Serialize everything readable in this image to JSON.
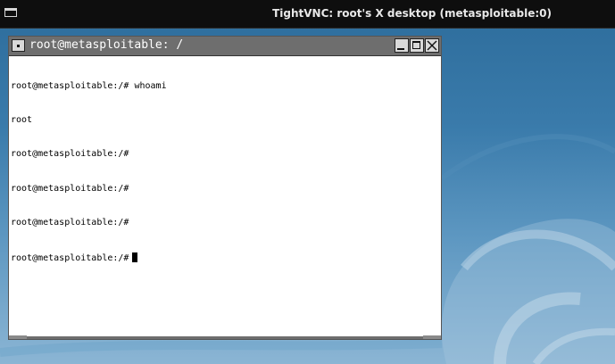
{
  "vnc": {
    "title": "TightVNC: root's X desktop (metasploitable:0)"
  },
  "xterm": {
    "title": "root@metasploitable: /",
    "lines": [
      "root@metasploitable:/# whoami",
      "root",
      "root@metasploitable:/#",
      "root@metasploitable:/#",
      "root@metasploitable:/#",
      "root@metasploitable:/#"
    ]
  },
  "icons": {
    "vnc_window_icon": "window-icon",
    "menu": "window-menu-icon",
    "minimize": "minimize-icon",
    "maximize": "maximize-icon",
    "close": "close-icon"
  },
  "colors": {
    "desktop_top": "#2d6c9b",
    "desktop_bottom": "#8bb5d4",
    "titlebar": "#6e6e6e",
    "vnc_bar": "#0e0e0e"
  }
}
